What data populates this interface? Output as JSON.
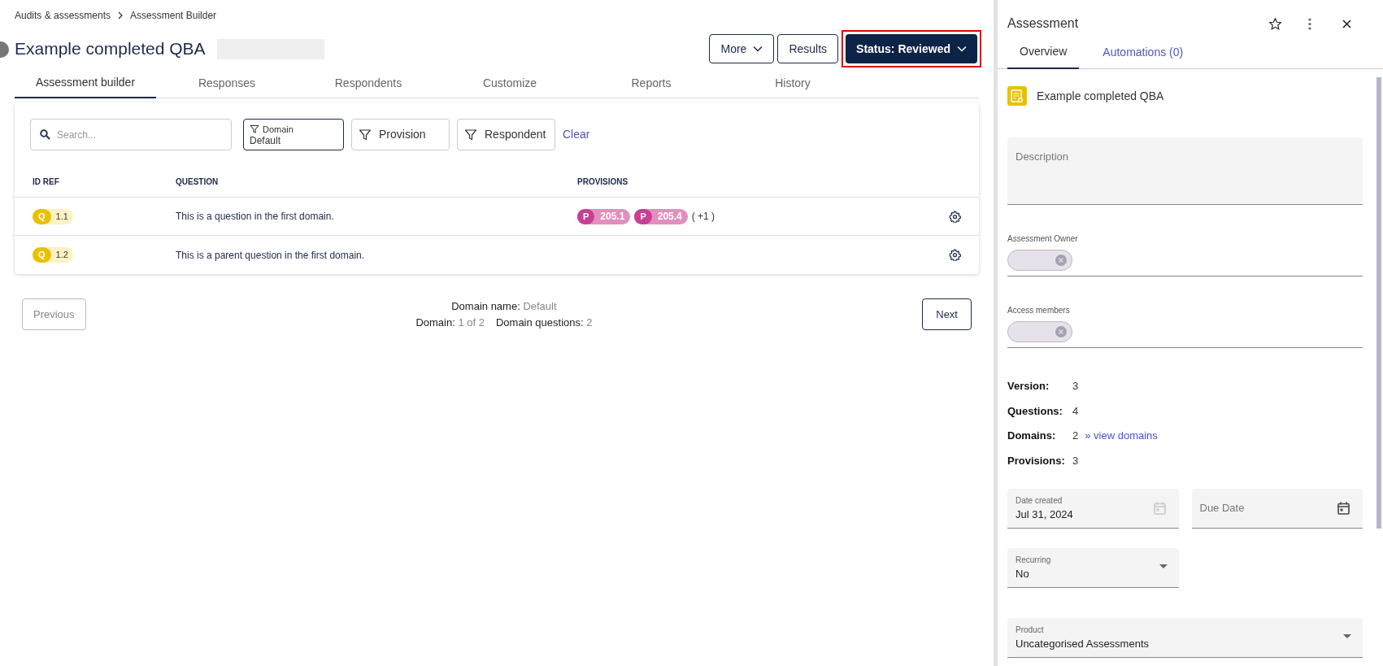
{
  "breadcrumb": [
    "Audits & assessments",
    "Assessment Builder"
  ],
  "title": "Example completed QBA",
  "actions": {
    "more": "More",
    "results": "Results",
    "status": {
      "label": "Status: Reviewed",
      "highlighted": true
    }
  },
  "tabs": [
    {
      "label": "Assessment builder",
      "selected": true
    },
    {
      "label": "Responses",
      "selected": false
    },
    {
      "label": "Respondents",
      "selected": false
    },
    {
      "label": "Customize",
      "selected": false
    },
    {
      "label": "Reports",
      "selected": false
    },
    {
      "label": "History",
      "selected": false
    }
  ],
  "search": {
    "placeholder": "Search..."
  },
  "filters": [
    {
      "label": "Domain",
      "value": "Default",
      "active": true
    },
    {
      "label": "Provision",
      "active": false
    },
    {
      "label": "Respondent",
      "active": false
    }
  ],
  "clear": "Clear",
  "table": {
    "columns": [
      "ID REF",
      "QUESTION",
      "PROVISIONS"
    ],
    "rows": [
      {
        "badge": "Q",
        "id": "1.1",
        "question": "This is a question in the first domain.",
        "provisions": [
          {
            "badge": "P",
            "id": "205.1"
          },
          {
            "badge": "P",
            "id": "205.4"
          }
        ],
        "more": "( +1 )"
      },
      {
        "badge": "Q",
        "id": "1.2",
        "question": "This is a parent question in the first domain.",
        "provisions": []
      }
    ]
  },
  "pagination": {
    "previous": {
      "label": "Previous",
      "disabled": true
    },
    "next": {
      "label": "Next",
      "disabled": false
    },
    "domain_name": {
      "label": "Domain name:",
      "value": "Default"
    },
    "domain": {
      "label": "Domain:",
      "value": "1 of 2"
    },
    "domain_questions": {
      "label": "Domain questions:",
      "value": "2"
    }
  },
  "panel": {
    "title": "Assessment",
    "tabs": [
      {
        "label": "Overview",
        "selected": true
      },
      {
        "label": "Automations (0)",
        "selected": false
      }
    ],
    "item_title": "Example completed QBA",
    "description": {
      "placeholder": "Description"
    },
    "owner": {
      "label": "Assessment Owner"
    },
    "access": {
      "label": "Access members"
    },
    "stats": [
      {
        "label": "Version:",
        "value": "3"
      },
      {
        "label": "Questions:",
        "value": "4"
      },
      {
        "label": "Domains:",
        "value": "2",
        "link": "» view domains"
      },
      {
        "label": "Provisions:",
        "value": "3"
      }
    ],
    "date_created": {
      "label": "Date created",
      "value": "Jul 31, 2024"
    },
    "due_date": {
      "placeholder": "Due Date"
    },
    "recurring": {
      "label": "Recurring",
      "value": "No"
    },
    "product": {
      "label": "Product",
      "value": "Uncategorised Assessments"
    }
  }
}
